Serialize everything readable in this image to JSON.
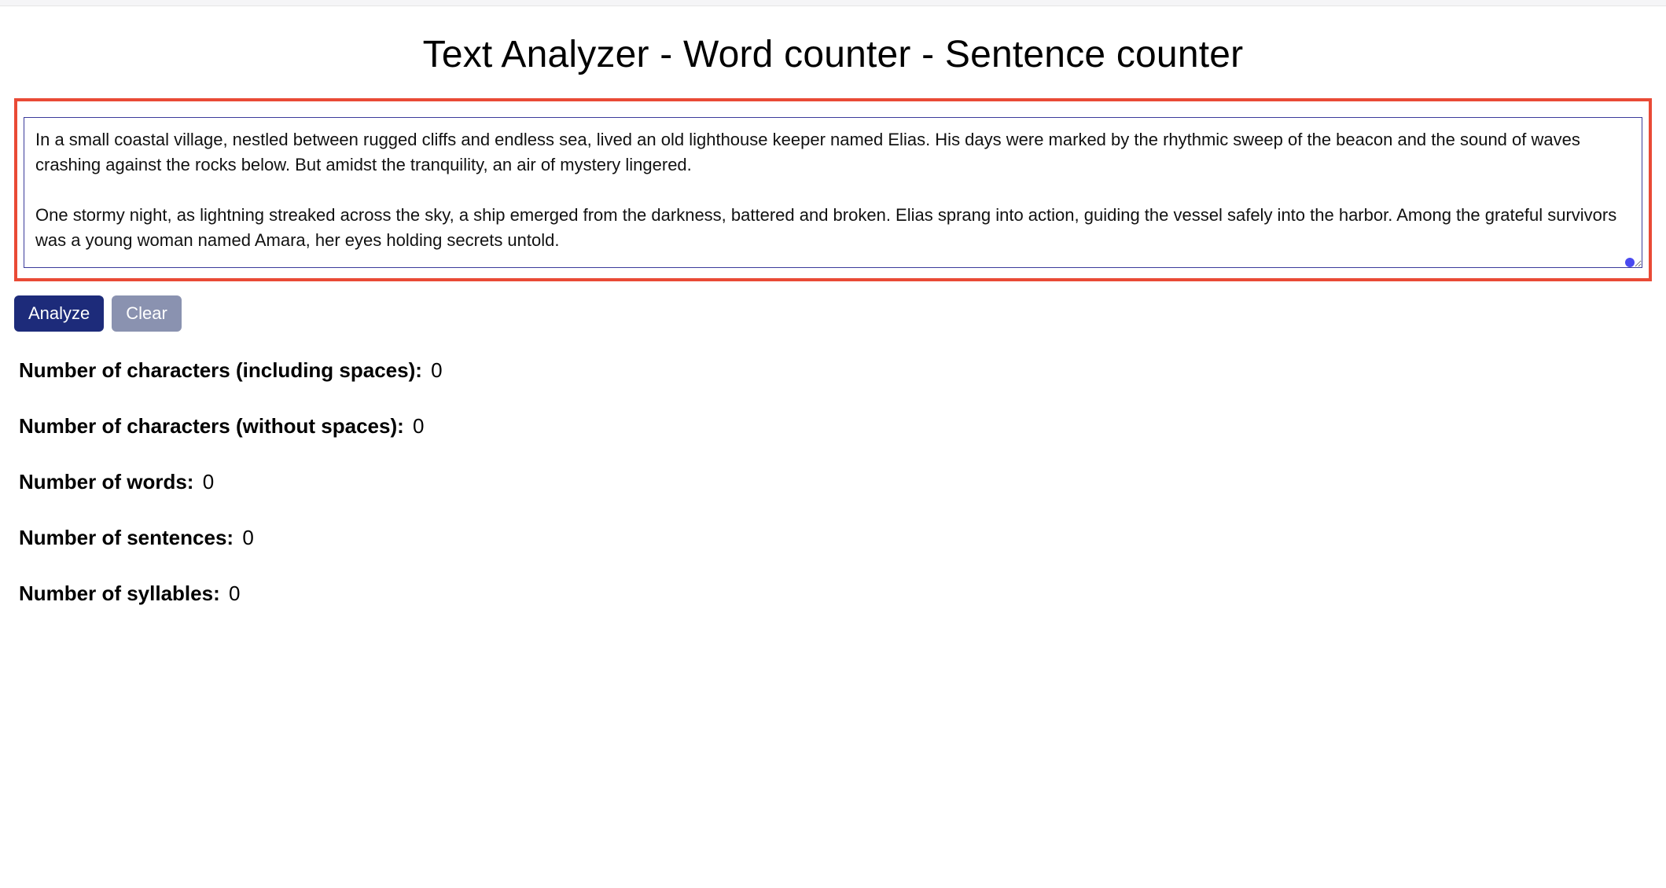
{
  "header": {
    "title": "Text Analyzer - Word counter - Sentence counter"
  },
  "input": {
    "value": "In a small coastal village, nestled between rugged cliffs and endless sea, lived an old lighthouse keeper named Elias. His days were marked by the rhythmic sweep of the beacon and the sound of waves crashing against the rocks below. But amidst the tranquility, an air of mystery lingered.\n\nOne stormy night, as lightning streaked across the sky, a ship emerged from the darkness, battered and broken. Elias sprang into action, guiding the vessel safely into the harbor. Among the grateful survivors was a young woman named Amara, her eyes holding secrets untold."
  },
  "buttons": {
    "analyze": "Analyze",
    "clear": "Clear"
  },
  "results": {
    "chars_with_spaces": {
      "label": "Number of characters (including spaces):",
      "value": "0"
    },
    "chars_without_spaces": {
      "label": "Number of characters (without spaces):",
      "value": "0"
    },
    "words": {
      "label": "Number of words:",
      "value": "0"
    },
    "sentences": {
      "label": "Number of sentences:",
      "value": "0"
    },
    "syllables": {
      "label": "Number of syllables:",
      "value": "0"
    }
  }
}
